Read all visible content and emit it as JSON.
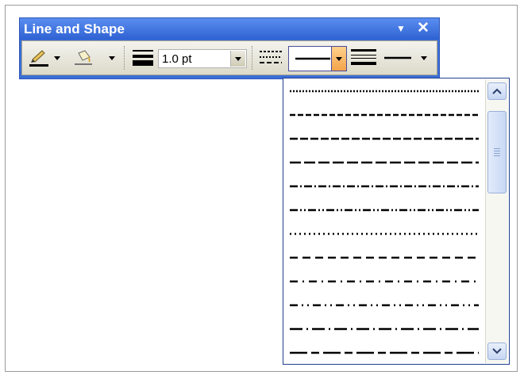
{
  "window": {
    "title": "Line and Shape",
    "menu_icon": "chevron-down-icon",
    "close_label": "✕"
  },
  "toolbar": {
    "line_color_icon": "pen-icon",
    "fill_color_icon": "paint-bucket-icon",
    "line_weight_icon": "line-weight-icon",
    "line_weight_value": "1.0 pt",
    "dash_style_icon": "dash-style-icon",
    "dash_current_icon": "solid-line-icon",
    "line_style_icon": "line-style-icon",
    "line_end_icon": "line-end-icon",
    "accent_color": "#f3a34a"
  },
  "dash_options": [
    {
      "name": "dash-square-dot",
      "pattern": "2 2"
    },
    {
      "name": "dash-short",
      "pattern": "7 3"
    },
    {
      "name": "dash-medium",
      "pattern": "10 3"
    },
    {
      "name": "dash-long",
      "pattern": "14 4"
    },
    {
      "name": "dash-dot",
      "pattern": "10 3 2 3"
    },
    {
      "name": "dash-dot-dot",
      "pattern": "10 3 2 3 2 3"
    },
    {
      "name": "dash-round-dot",
      "pattern": "2 4"
    },
    {
      "name": "dash-medium-spaced",
      "pattern": "10 6"
    },
    {
      "name": "dash-dot-spaced",
      "pattern": "10 6 2 6"
    },
    {
      "name": "dash-dot-dot-spaced",
      "pattern": "10 5 2 5 2 5"
    },
    {
      "name": "dash-long-dot",
      "pattern": "16 5 2 5"
    },
    {
      "name": "dash-long-short",
      "pattern": "22 5 10 5"
    }
  ]
}
